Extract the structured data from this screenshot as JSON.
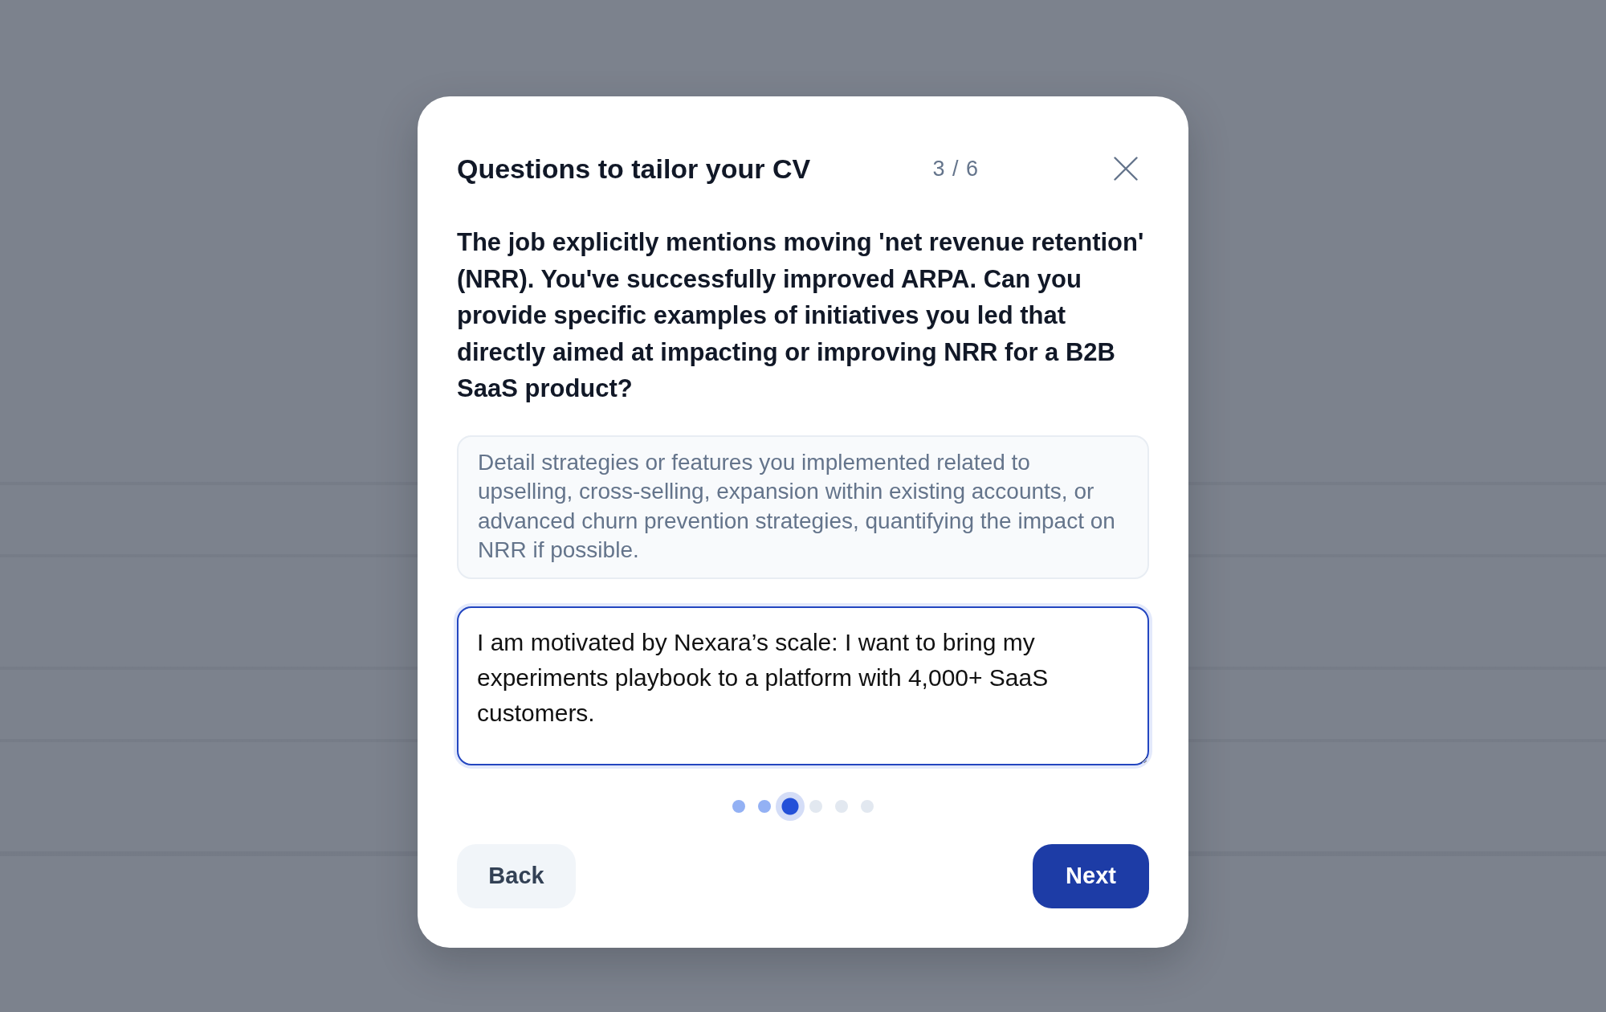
{
  "dialog": {
    "title": "Questions to tailor your CV",
    "step_counter": "3 / 6",
    "question": "The job explicitly mentions moving 'net revenue retention' (NRR). You've successfully improved ARPA. Can you provide specific examples of initiatives you led that directly aimed at impacting or improving NRR for a B2B SaaS product?",
    "hint": "Detail strategies or features you implemented related to upselling, cross-selling, expansion within existing accounts, or advanced churn prevention strategies, quantifying the impact on NRR if possible.",
    "answer": {
      "value": "I am motivated by Nexara’s scale: I want to bring my experiments playbook to a platform with 4,000+ SaaS customers.",
      "focused": true
    },
    "steps": [
      {
        "completed": true,
        "selected": false
      },
      {
        "completed": true,
        "selected": false
      },
      {
        "completed": false,
        "selected": true
      },
      {
        "completed": false,
        "selected": false
      },
      {
        "completed": false,
        "selected": false
      },
      {
        "completed": false,
        "selected": false
      }
    ],
    "buttons": [
      {
        "label": "Back",
        "kind": "secondary"
      },
      {
        "label": "Next",
        "kind": "primary"
      }
    ]
  }
}
